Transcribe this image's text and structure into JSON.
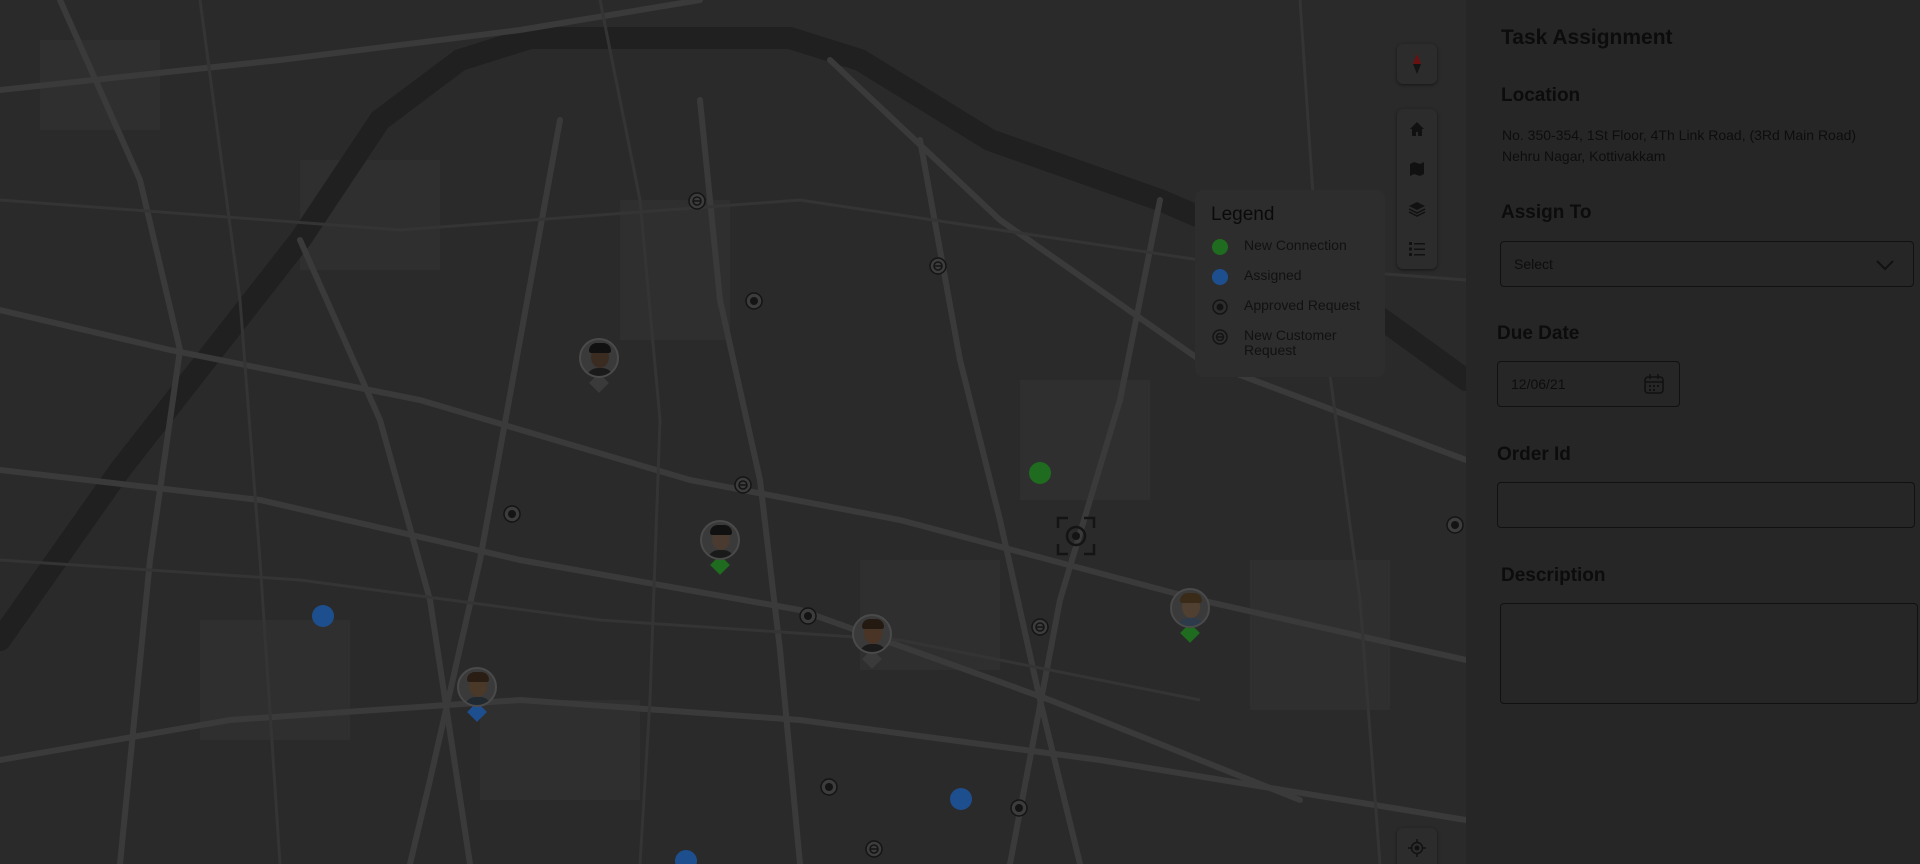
{
  "panel": {
    "title": "Task Assignment",
    "location_label": "Location",
    "address_line1": "No. 350-354, 1St Floor, 4Th Link Road,  (3Rd Main Road)",
    "address_line2": "Nehru Nagar, Kottivakkam",
    "assign_label": "Assign To",
    "assign_value": "Select",
    "due_label": "Due Date",
    "due_value": "12/06/21",
    "order_label": "Order Id",
    "order_value": "",
    "description_label": "Description",
    "description_value": ""
  },
  "legend": {
    "title": "Legend",
    "items": [
      {
        "label": "New Connection",
        "color": "#1f6b1f"
      },
      {
        "label": "Assigned",
        "color": "#1d4f8f"
      },
      {
        "label": "Approved Request",
        "color": "#141414"
      },
      {
        "label": "New Customer Request",
        "color": "#141414"
      }
    ]
  },
  "colors": {
    "new_connection": "#1f6b1f",
    "assigned": "#1d4f8f",
    "map_bg": "#2a2a2a",
    "panel_bg": "#262626"
  },
  "map_controls": [
    "compass-icon",
    "home-icon",
    "map-icon",
    "layers-icon",
    "list-icon",
    "locate-icon"
  ]
}
